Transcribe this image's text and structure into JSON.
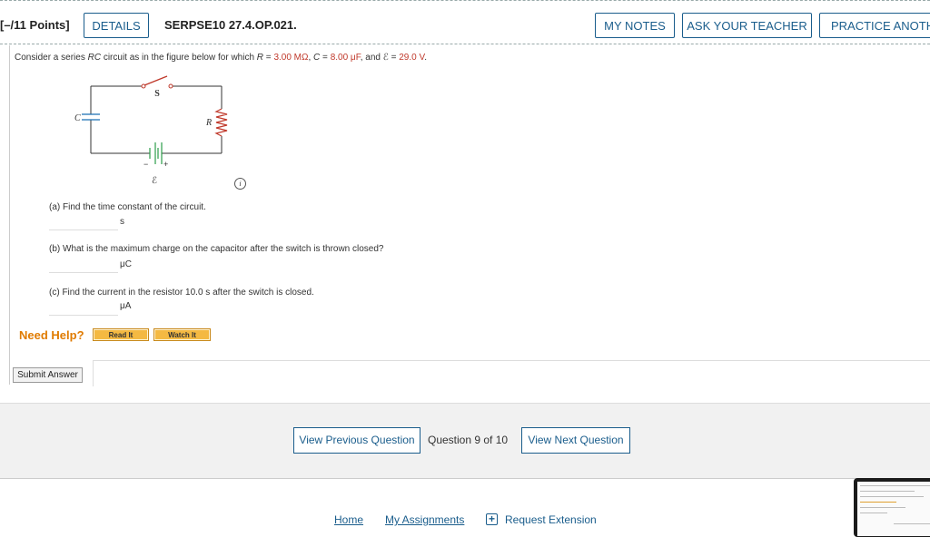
{
  "header": {
    "points": "[–/11 Points]",
    "details_label": "DETAILS",
    "question_id": "SERPSE10 27.4.OP.021.",
    "my_notes_label": "MY NOTES",
    "ask_teacher_label": "ASK YOUR TEACHER",
    "practice_label": "PRACTICE ANOTHER"
  },
  "prompt": {
    "text_before": "Consider a series ",
    "rc": "RC",
    "text_mid": " circuit as in the figure below for which ",
    "r_sym": "R",
    "eq": " = ",
    "r_val": "3.00 MΩ",
    "comma1": ", ",
    "c_sym": "C",
    "c_val": "8.00 μF",
    "and": ", and ",
    "emf_sym": "ℰ",
    "emf_val": "29.0 V",
    "end": "."
  },
  "circuit": {
    "switch_label": "S",
    "capacitor_label": "C",
    "resistor_label": "R",
    "battery_label": "ℰ",
    "minus": "−",
    "plus": "+",
    "info_icon": "i"
  },
  "parts": [
    {
      "question": "(a) Find the time constant of the circuit.",
      "value": "",
      "unit": "s"
    },
    {
      "question": "(b) What is the maximum charge on the capacitor after the switch is thrown closed?",
      "value": "",
      "unit": "μC"
    },
    {
      "question": "(c) Find the current in the resistor 10.0 s after the switch is closed.",
      "value": "",
      "unit": "μA"
    }
  ],
  "help": {
    "label": "Need Help?",
    "read_it": "Read It",
    "watch_it": "Watch It"
  },
  "submit_label": "Submit Answer",
  "navigation": {
    "prev_label": "View Previous Question",
    "count": "Question 9 of 10",
    "next_label": "View Next Question"
  },
  "footer": {
    "home": "Home",
    "assignments": "My Assignments",
    "extension": "Request Extension"
  },
  "colors": {
    "accent": "#1a5d8c",
    "value_red": "#c0392b",
    "help_orange": "#e07b00"
  }
}
